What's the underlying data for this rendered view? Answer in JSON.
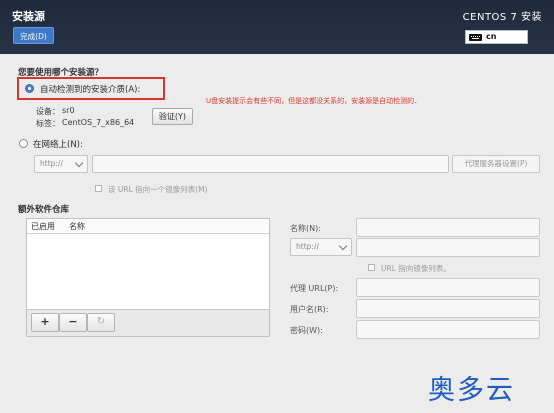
{
  "header": {
    "title": "安装源",
    "done_label": "完成(D)",
    "product": "CENTOS 7 安装",
    "keyboard_layout": "cn"
  },
  "source": {
    "question": "您要使用哪个安装源？",
    "auto_detect_label": "自动检测到的安装介质(A):",
    "auto_detect_selected": true,
    "annotation": "U盘安装提示会有些不同，但是这都没关系的，安装源是自动检测的．",
    "device_label": "设备：",
    "device_value": "sr0",
    "disk_label_label": "标签：",
    "disk_label_value": "CentOS_7_x86_64",
    "verify_label": "验证(Y)",
    "network_label": "在网络上(N):",
    "network_selected": false,
    "protocol_value": "http://",
    "url_value": "",
    "proxy_button_label": "代理服务器设置(P)",
    "mirrorlist_label": "该 URL 指向一个镜像列表(M)"
  },
  "repos": {
    "title": "额外软件仓库",
    "columns": [
      "已启用",
      "名称"
    ],
    "rows": [],
    "add_label": "+",
    "remove_label": "−",
    "reset_label": "↻",
    "name_label": "名称(N):",
    "protocol_value": "http://",
    "mirrorlist_label": "URL 指向镜像列表。",
    "proxy_url_label": "代理 URL(P):",
    "username_label": "用户名(R):",
    "password_label": "密码(W):"
  },
  "watermark": "奥多云"
}
